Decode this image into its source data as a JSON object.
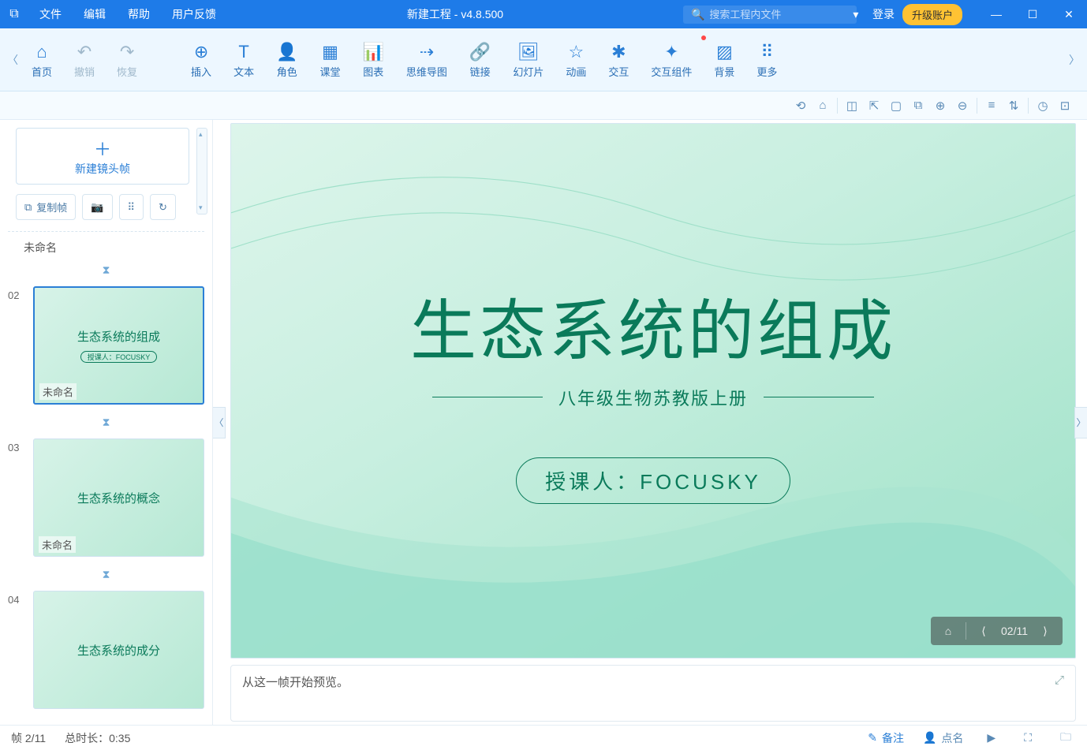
{
  "titlebar": {
    "menus": [
      "文件",
      "编辑",
      "帮助",
      "用户反馈"
    ],
    "title": "新建工程 - v4.8.500",
    "search_placeholder": "搜索工程内文件",
    "login": "登录",
    "upgrade": "升级账户"
  },
  "ribbon": {
    "items": [
      {
        "label": "首页",
        "icon": "⌂",
        "disabled": false
      },
      {
        "label": "撤销",
        "icon": "↶",
        "disabled": true
      },
      {
        "label": "恢复",
        "icon": "↷",
        "disabled": true
      },
      {
        "label": "插入",
        "icon": "⊕",
        "disabled": false,
        "gap": true
      },
      {
        "label": "文本",
        "icon": "T",
        "disabled": false
      },
      {
        "label": "角色",
        "icon": "👤",
        "disabled": false
      },
      {
        "label": "课堂",
        "icon": "▦",
        "disabled": false
      },
      {
        "label": "图表",
        "icon": "📊",
        "disabled": false
      },
      {
        "label": "思维导图",
        "icon": "⇢",
        "disabled": false
      },
      {
        "label": "链接",
        "icon": "🔗",
        "disabled": false
      },
      {
        "label": "幻灯片",
        "icon": "🖼",
        "disabled": false
      },
      {
        "label": "动画",
        "icon": "☆",
        "disabled": false
      },
      {
        "label": "交互",
        "icon": "✱",
        "disabled": false
      },
      {
        "label": "交互组件",
        "icon": "✦",
        "disabled": false,
        "dot": true
      },
      {
        "label": "背景",
        "icon": "▨",
        "disabled": false
      },
      {
        "label": "更多",
        "icon": "⠿",
        "disabled": false
      }
    ]
  },
  "toolbar2_icons": [
    "⟲",
    "⌂",
    "◫",
    "⇱",
    "▢",
    "⧉",
    "⊕",
    "⊖",
    "≡",
    "⇅",
    "◷",
    "⊡"
  ],
  "sidebar": {
    "new_frame": "新建镜头帧",
    "tools": {
      "copy": "复制帧"
    },
    "slides": [
      {
        "num": "02",
        "name": "未命名",
        "title": "生态系统的组成",
        "pill": "授课人：FOCUSKY",
        "selected": true
      },
      {
        "num": "03",
        "name": "未命名",
        "title": "生态系统的概念",
        "selected": false
      },
      {
        "num": "04",
        "name": "",
        "title": "生态系统的成分",
        "selected": false
      }
    ],
    "top_label": "未命名"
  },
  "canvas": {
    "title": "生态系统的组成",
    "subtitle": "八年级生物苏教版上册",
    "teacher": "授课人：FOCUSKY",
    "nav_counter": "02/11"
  },
  "notes": {
    "placeholder": "从这一帧开始预览。"
  },
  "status": {
    "frame": "帧 2/11",
    "duration": "总时长：0:35",
    "remark": "备注",
    "roll": "点名"
  }
}
